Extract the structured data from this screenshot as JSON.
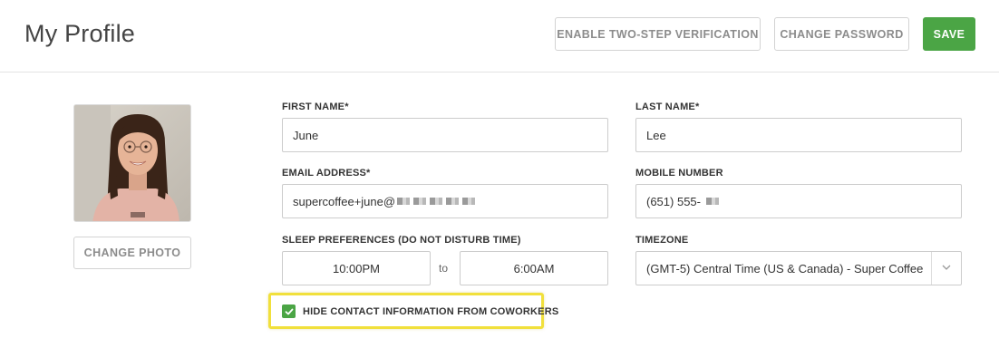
{
  "header": {
    "title": "My Profile",
    "enable_2fa_label": "ENABLE TWO-STEP VERIFICATION",
    "change_password_label": "CHANGE PASSWORD",
    "save_label": "SAVE"
  },
  "photo": {
    "change_photo_label": "CHANGE PHOTO"
  },
  "form": {
    "first_name": {
      "label": "FIRST NAME*",
      "value": "June"
    },
    "last_name": {
      "label": "LAST NAME*",
      "value": "Lee"
    },
    "email": {
      "label": "EMAIL ADDRESS*",
      "value": "supercoffee+june@"
    },
    "mobile": {
      "label": "MOBILE NUMBER",
      "value": "(651) 555-"
    },
    "sleep": {
      "label": "SLEEP PREFERENCES (DO NOT DISTURB TIME)",
      "start": "10:00PM",
      "separator": "to",
      "end": "6:00AM"
    },
    "timezone": {
      "label": "TIMEZONE",
      "value": "(GMT-5) Central Time (US & Canada) - Super Coffee"
    },
    "hide_contact": {
      "label": "HIDE CONTACT INFORMATION FROM COWORKERS",
      "checked": true
    }
  },
  "colors": {
    "accent_green": "#4ba545",
    "highlight_yellow": "#f1e03c"
  },
  "icons": {
    "check": "checkmark-icon",
    "chevron": "chevron-down-icon"
  }
}
